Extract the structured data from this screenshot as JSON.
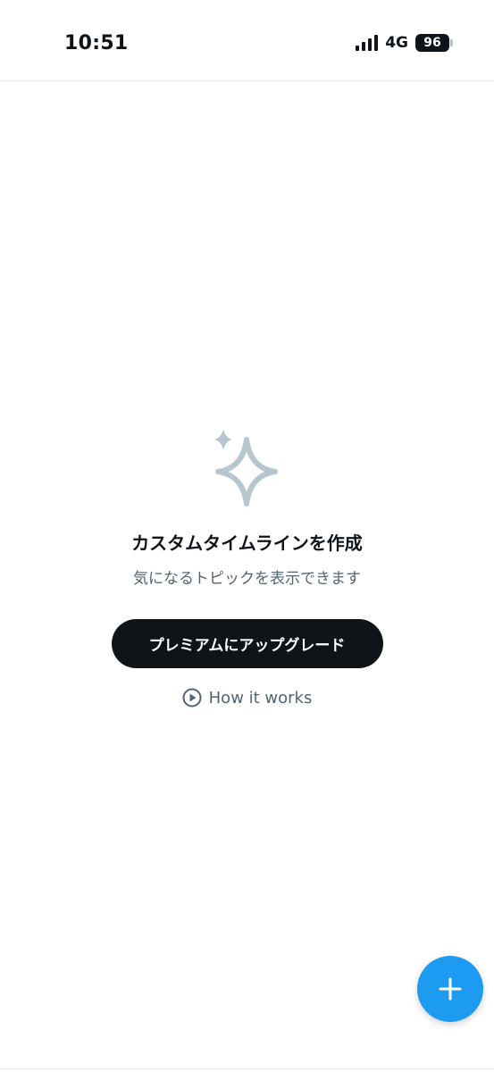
{
  "status_bar": {
    "time": "10:51",
    "network": "4G",
    "battery": "96"
  },
  "empty_state": {
    "icon": "sparkle-icon",
    "title": "カスタムタイムラインを作成",
    "subtitle": "気になるトピックを表示できます",
    "upgrade_label": "プレミアムにアップグレード",
    "how_it_works_label": "How it works"
  },
  "fab": {
    "icon": "plus-icon"
  },
  "colors": {
    "text_primary": "#0f1419",
    "text_secondary": "#536471",
    "accent": "#1d9bf0",
    "sparkle": "#b6c6cf"
  }
}
